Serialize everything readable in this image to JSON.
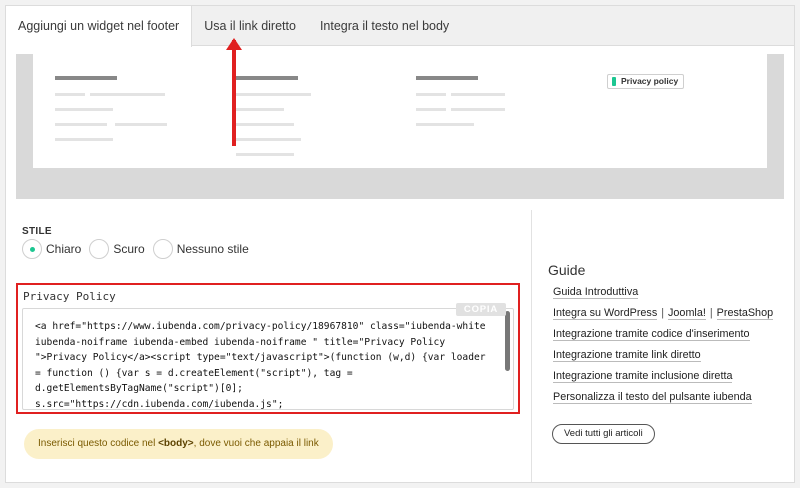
{
  "tabs": [
    {
      "label": "Aggiungi un widget nel footer",
      "active": true
    },
    {
      "label": "Usa il link diretto",
      "active": false
    },
    {
      "label": "Integra il testo nel body",
      "active": false
    }
  ],
  "preview": {
    "badge_label": "Privacy policy",
    "badge_icon": "iubenda-logo-icon"
  },
  "style": {
    "label": "STILE",
    "options": [
      {
        "label": "Chiaro",
        "checked": true
      },
      {
        "label": "Scuro",
        "checked": false
      },
      {
        "label": "Nessuno stile",
        "checked": false
      }
    ]
  },
  "code": {
    "title": "Privacy Policy",
    "copy_label": "COPIA",
    "content": "<a href=\"https://www.iubenda.com/privacy-policy/18967810\" class=\"iubenda-white\niubenda-noiframe iubenda-embed iubenda-noiframe \" title=\"Privacy Policy\n\">Privacy Policy</a><script type=\"text/javascript\">(function (w,d) {var loader\n= function () {var s = d.createElement(\"script\"), tag =\nd.getElementsByTagName(\"script\")[0];\ns.src=\"https://cdn.iubenda.com/iubenda.js\";"
  },
  "hint": {
    "before": "Inserisci questo codice nel ",
    "tag": "<body>",
    "after": ", dove vuoi che appaia il link"
  },
  "guide": {
    "title": "Guide",
    "links": [
      "Guida Introduttiva",
      "Integra su WordPress",
      "Joomla!",
      "PrestaShop",
      "Integrazione tramite codice d'inserimento",
      "Integrazione tramite link diretto",
      "Integrazione tramite inclusione diretta",
      "Personalizza il testo del pulsante iubenda"
    ],
    "separator": "|",
    "all_articles": "Vedi tutti gli articoli"
  },
  "colors": {
    "accent_green": "#1cc691",
    "highlight_red": "#e02020",
    "hint_bg": "#fbf0c9"
  }
}
